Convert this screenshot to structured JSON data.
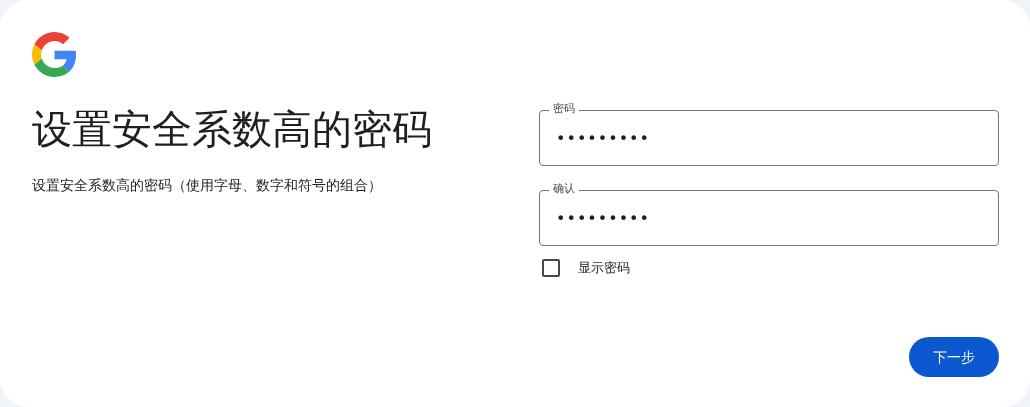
{
  "title": "设置安全系数高的密码",
  "subtitle": "设置安全系数高的密码（使用字母、数字和符号的组合）",
  "fields": [
    {
      "label": "密码",
      "value": "•••••••••"
    },
    {
      "label": "确认",
      "value": "•••••••••"
    }
  ],
  "show_password": {
    "label": "显示密码",
    "checked": false
  },
  "buttons": [
    {
      "label": "下一步",
      "kind": "primary"
    }
  ]
}
